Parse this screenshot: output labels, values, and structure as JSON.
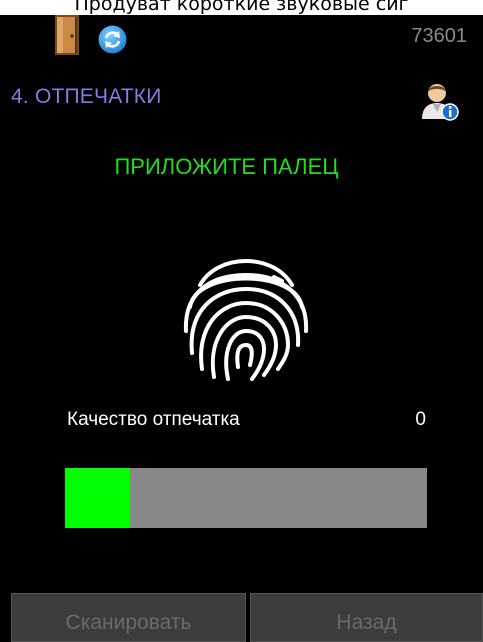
{
  "caption": "Продуват короткие звуковые сиг",
  "header": {
    "device_id": "73601",
    "icons": [
      "door-icon",
      "sync-icon",
      "user-info-icon"
    ]
  },
  "step": {
    "title": "4. ОТПЕЧАТКИ"
  },
  "instruction": "ПРИЛОЖИТЕ ПАЛЕЦ",
  "quality": {
    "label": "Качество отпечатка",
    "value": "0",
    "progress_percent": 18
  },
  "buttons": {
    "scan_label": "Сканировать",
    "back_label": "Назад"
  },
  "colors": {
    "background": "#000000",
    "title": "#7e7ee6",
    "instruction": "#22dd22",
    "progress_fill": "#00ff00",
    "progress_track": "#888888"
  }
}
